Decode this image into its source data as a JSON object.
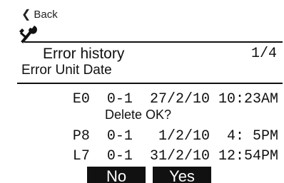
{
  "nav": {
    "back_label": "Back"
  },
  "header": {
    "title": "Error  history",
    "page": "1/4"
  },
  "columns_header": "Error  Unit  Date",
  "rows": [
    {
      "code": "E0",
      "unit": "0-1",
      "date": "27/2/10",
      "time": "10:23AM"
    },
    {
      "code": "P8",
      "unit": "0-1",
      "date": "1/2/10",
      "time": "4: 5PM"
    },
    {
      "code": "L7",
      "unit": "0-1",
      "date": "31/2/10",
      "time": "12:54PM"
    }
  ],
  "dialog": {
    "message": "Delete OK?",
    "no_label": "No",
    "yes_label": "Yes"
  }
}
